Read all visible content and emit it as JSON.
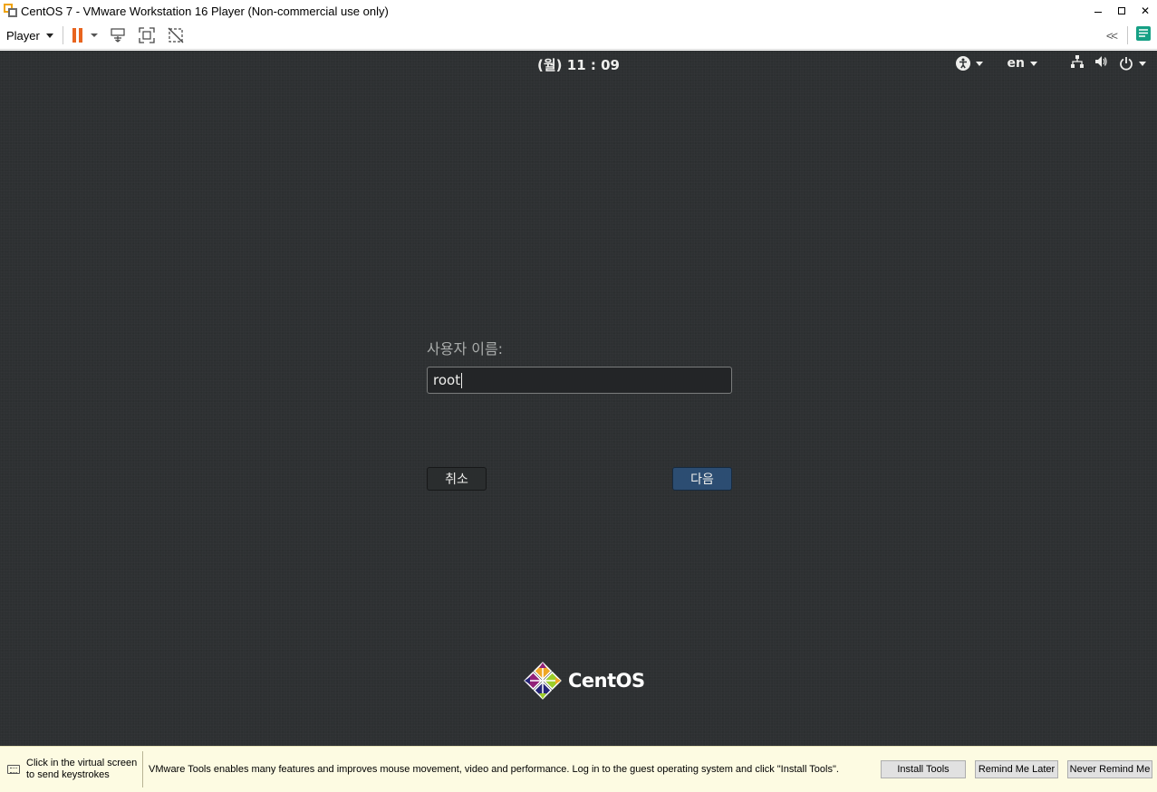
{
  "window": {
    "title": "CentOS 7 - VMware Workstation 16 Player (Non-commercial use only)",
    "controls": {
      "minimize": "",
      "maximize": "",
      "close": "✕"
    }
  },
  "toolbar": {
    "player_label": "Player",
    "collapse_glyph": "<<"
  },
  "gnome_bar": {
    "clock": "(월) 11 : 09",
    "language": "en"
  },
  "login": {
    "username_label": "사용자 이름:",
    "username_value": "root",
    "cancel_label": "취소",
    "next_label": "다음"
  },
  "branding": {
    "os_name": "CentOS"
  },
  "notification": {
    "click_hint_line1": "Click in the virtual screen",
    "click_hint_line2": "to send keystrokes",
    "message": "VMware Tools enables many features and improves mouse movement, video and performance. Log in to the guest operating system and click \"Install Tools\".",
    "install_label": "Install Tools",
    "remind_label": "Remind Me Later",
    "never_label": "Never Remind Me"
  },
  "colors": {
    "pause_accent": "#e8641e",
    "guest_background": "#2d3032",
    "next_button": "#2c4d72",
    "notification_bg": "#fdfbe2"
  }
}
